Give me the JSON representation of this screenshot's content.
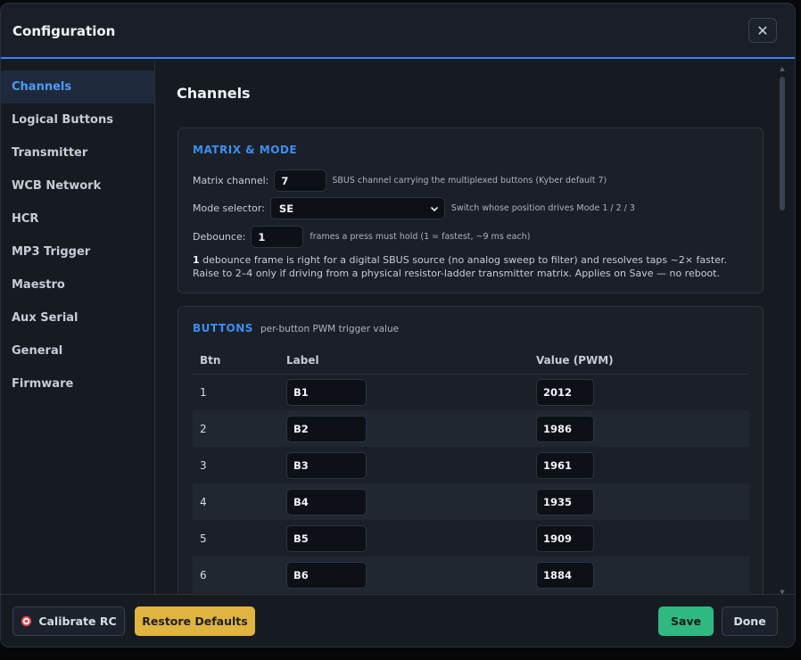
{
  "dialog": {
    "title": "Configuration"
  },
  "sidebar": {
    "items": [
      {
        "label": "Channels",
        "active": true
      },
      {
        "label": "Logical Buttons",
        "active": false
      },
      {
        "label": "Transmitter",
        "active": false
      },
      {
        "label": "WCB Network",
        "active": false
      },
      {
        "label": "HCR",
        "active": false
      },
      {
        "label": "MP3 Trigger",
        "active": false
      },
      {
        "label": "Maestro",
        "active": false
      },
      {
        "label": "Aux Serial",
        "active": false
      },
      {
        "label": "General",
        "active": false
      },
      {
        "label": "Firmware",
        "active": false
      }
    ]
  },
  "main": {
    "title": "Channels",
    "matrix": {
      "heading": "MATRIX & MODE",
      "matrix_channel": {
        "label": "Matrix channel:",
        "value": "7",
        "hint": "SBUS channel carrying the multiplexed buttons (Kyber default 7)"
      },
      "mode_selector": {
        "label": "Mode selector:",
        "value": "SE",
        "hint": "Switch whose position drives Mode 1 / 2 / 3"
      },
      "debounce": {
        "label": "Debounce:",
        "value": "1",
        "hint": "frames a press must hold (1 = fastest, ~9 ms each)"
      },
      "note_bold": "1",
      "note_text": " debounce frame is right for a digital SBUS source (no analog sweep to filter) and resolves taps ~2× faster. Raise to 2–4 only if driving from a physical resistor-ladder transmitter matrix. Applies on Save — no reboot."
    },
    "buttons": {
      "heading": "BUTTONS",
      "subheading": "per-button PWM trigger value",
      "columns": [
        "Btn",
        "Label",
        "Value (PWM)"
      ],
      "rows": [
        {
          "btn": "1",
          "label": "B1",
          "value": "2012"
        },
        {
          "btn": "2",
          "label": "B2",
          "value": "1986"
        },
        {
          "btn": "3",
          "label": "B3",
          "value": "1961"
        },
        {
          "btn": "4",
          "label": "B4",
          "value": "1935"
        },
        {
          "btn": "5",
          "label": "B5",
          "value": "1909"
        },
        {
          "btn": "6",
          "label": "B6",
          "value": "1884"
        }
      ]
    }
  },
  "footer": {
    "calibrate_label": "Calibrate RC",
    "restore_label": "Restore Defaults",
    "save_label": "Save",
    "done_label": "Done"
  },
  "colors": {
    "accent": "#3b82f6",
    "active_nav_text": "#4e9bf7",
    "save": "#2fb981",
    "restore": "#e1b43f"
  },
  "icons": {
    "close": "close-icon",
    "calibrate": "target-icon",
    "select": "chevron-down-icon"
  }
}
